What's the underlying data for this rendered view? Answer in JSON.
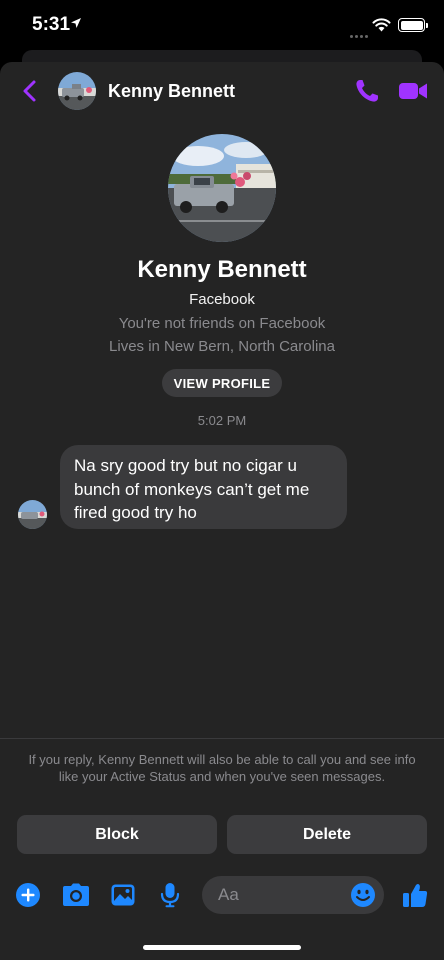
{
  "status_bar": {
    "time": "5:31",
    "icons": [
      "location-arrow-icon",
      "cellular-icon",
      "wifi-icon",
      "battery-icon"
    ]
  },
  "header": {
    "contact_name": "Kenny Bennett",
    "icons": [
      "back-chevron-icon",
      "phone-icon",
      "video-camera-icon"
    ]
  },
  "profile": {
    "name": "Kenny Bennett",
    "source": "Facebook",
    "friend_status": "You're not friends on Facebook",
    "location": "Lives in New Bern, North Carolina",
    "view_profile_label": "VIEW PROFILE"
  },
  "conversation": {
    "timestamp": "5:02 PM",
    "messages": [
      {
        "line1": "Na sry good try but no cigar u",
        "line2": "bunch of monkeys can’t get me",
        "line3": "fired good try ho"
      }
    ]
  },
  "request_footer": {
    "notice": "If you reply, Kenny Bennett will also be able to call you and see info like your Active Status and when you've seen messages.",
    "block_label": "Block",
    "delete_label": "Delete"
  },
  "composer": {
    "placeholder": "Aa",
    "icons": [
      "plus-circle-icon",
      "camera-icon",
      "photo-icon",
      "microphone-icon",
      "emoji-icon",
      "thumbs-up-icon"
    ]
  },
  "colors": {
    "accent_purple": "#a033ff",
    "accent_blue": "#1e88ff",
    "background": "#242424",
    "bubble": "#3a3a3c",
    "secondary_text": "#8a8a8e"
  }
}
